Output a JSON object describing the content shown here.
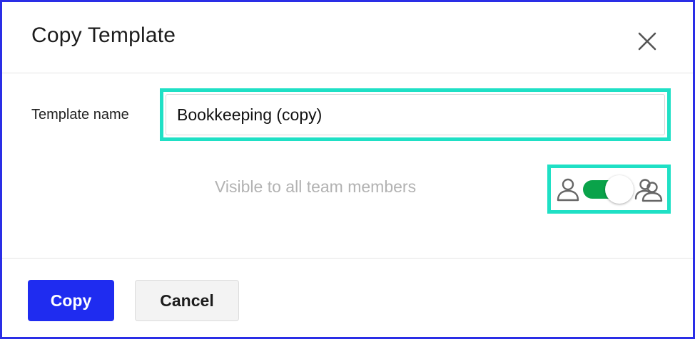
{
  "dialog": {
    "title": "Copy Template"
  },
  "form": {
    "template_name_label": "Template name",
    "template_name_value": "Bookkeeping (copy)",
    "visibility_label": "Visible to all team members",
    "visibility_on": true
  },
  "footer": {
    "copy_label": "Copy",
    "cancel_label": "Cancel"
  },
  "colors": {
    "primary": "#1f2cf0",
    "toggle_on": "#0aa34a",
    "highlight": "#1fe0c5",
    "frame": "#2a2ee6"
  },
  "icons": {
    "close": "close-icon",
    "single_user": "user-icon",
    "team": "users-icon"
  }
}
